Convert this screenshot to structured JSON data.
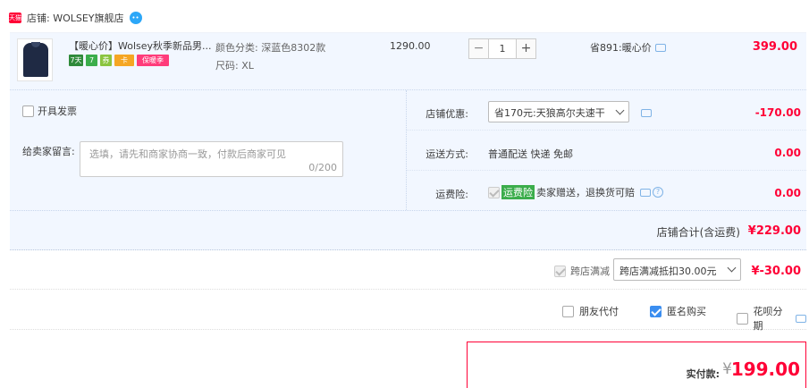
{
  "shop": {
    "badge": "天猫",
    "name": "店铺: WOLSEY旗舰店",
    "ww_icon": "chat-bubble-icon"
  },
  "item": {
    "title": "【暖心价】Wolsey秋季新品男...",
    "tags": [
      {
        "text": "7天",
        "color": "#2f8a3a"
      },
      {
        "text": "7",
        "color": "#3bad4b"
      },
      {
        "text": "券",
        "color": "#8ac43f"
      },
      {
        "text": "卡",
        "color": "#f5a623"
      },
      {
        "text": "保暖季",
        "color": "#ff3c7a"
      }
    ],
    "prop_color": "颜色分类: 深蓝色8302款",
    "prop_size": "尺码: XL",
    "unit_price": "1290.00",
    "quantity": "1",
    "minus": "−",
    "plus": "+",
    "saved": "省891:暖心价",
    "total": "399.00"
  },
  "invoice": {
    "label": "开具发票"
  },
  "message": {
    "label": "给卖家留言:",
    "placeholder": "选填，请先和商家协商一致，付款后商家可见",
    "count": "0/200"
  },
  "coupon": {
    "label": "店铺优惠:",
    "selected": "省170元:天狼高尔夫速干",
    "amount": "-170.00"
  },
  "shipping": {
    "label": "运送方式:",
    "value": "普通配送 快递 免邮",
    "amount": "0.00"
  },
  "insurance": {
    "label": "运费险:",
    "badge": "运费险",
    "value": "卖家赠送，退换货可赔",
    "amount": "0.00"
  },
  "shop_total": {
    "label": "店铺合计(含运费)",
    "amount": "¥229.00"
  },
  "cross_store": {
    "label": "跨店满减",
    "selected": "跨店满减抵扣30.00元",
    "amount": "¥-30.00"
  },
  "payment_options": [
    {
      "label": "朋友代付",
      "checked": false
    },
    {
      "label": "匿名购买",
      "checked": true
    },
    {
      "label": "花呗分期",
      "checked": false
    }
  ],
  "final": {
    "label": "实付款:",
    "yen": "¥",
    "amount": "199.00"
  },
  "colors": {
    "accent": "#ff0036",
    "panel_bg": "#f2f7ff",
    "link_blue": "#3b8ef0"
  }
}
